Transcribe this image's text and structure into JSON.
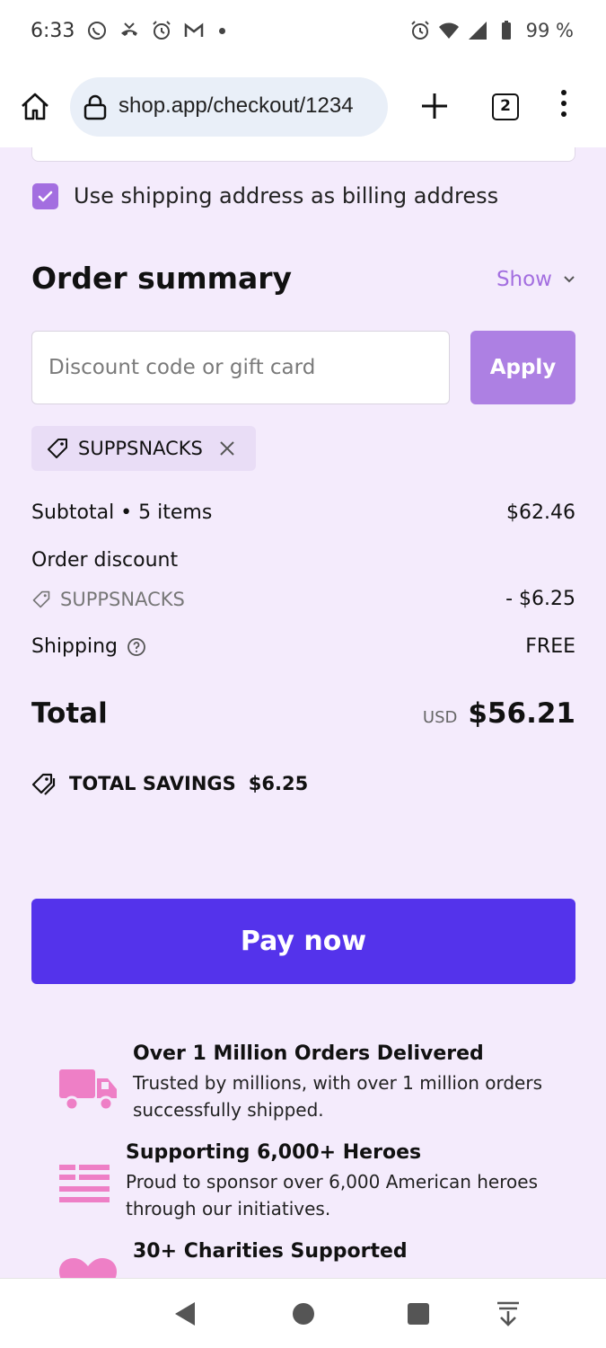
{
  "status_bar": {
    "time": "6:33",
    "battery": "99 %"
  },
  "browser": {
    "url": "shop.app/checkout/1234",
    "tab_count": "2"
  },
  "checkout": {
    "billing_same_label": "Use shipping address as billing address",
    "billing_same_checked": true,
    "order_summary_title": "Order summary",
    "show_toggle": "Show",
    "discount_placeholder": "Discount code or gift card",
    "apply_label": "Apply",
    "applied_code": "SUPPSNACKS",
    "subtotal_label": "Subtotal • 5 items",
    "subtotal_value": "$62.46",
    "order_discount_label": "Order discount",
    "discount_code_label": "SUPPSNACKS",
    "discount_value": "- $6.25",
    "shipping_label": "Shipping",
    "shipping_value": "FREE",
    "total_label": "Total",
    "currency": "USD",
    "total_value": "$56.21",
    "savings_label": "TOTAL SAVINGS",
    "savings_value": "$6.25",
    "pay_label": "Pay now"
  },
  "features": [
    {
      "icon": "truck-icon",
      "title": "Over 1 Million Orders Delivered",
      "desc": "Trusted by millions, with over 1 million orders successfully shipped."
    },
    {
      "icon": "flag-icon",
      "title": "Supporting 6,000+ Heroes",
      "desc": "Proud to sponsor over 6,000 American heroes through our initiatives."
    },
    {
      "icon": "heart-icon",
      "title": "30+ Charities Supported",
      "desc": ""
    }
  ],
  "colors": {
    "accent": "#a36ee0",
    "pay_button": "#5433eb",
    "background": "#f4ebfc",
    "icon_pink": "#ee7fc6"
  }
}
